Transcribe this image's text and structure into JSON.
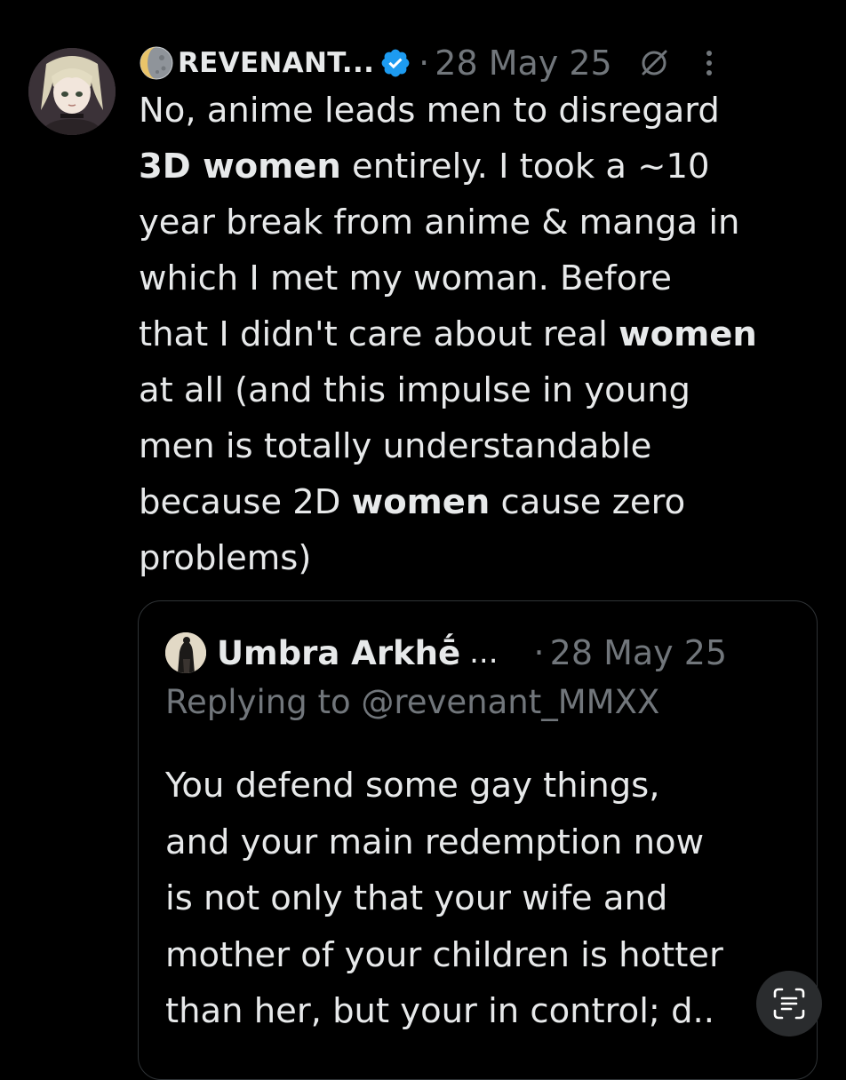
{
  "tweet": {
    "display_name": "REVENANT...",
    "separator": "·",
    "date": "28 May 25",
    "text_lines": [
      [
        {
          "t": "No, anime leads men to disregard",
          "b": false
        }
      ],
      [
        {
          "t": "3D women",
          "b": true
        },
        {
          "t": " entirely. I took a ~10",
          "b": false
        }
      ],
      [
        {
          "t": "year break from anime & manga in",
          "b": false
        }
      ],
      [
        {
          "t": "which I met my woman. Before",
          "b": false
        }
      ],
      [
        {
          "t": "that I didn't care about real ",
          "b": false
        },
        {
          "t": "women",
          "b": true
        }
      ],
      [
        {
          "t": "at all (and this impulse in young",
          "b": false
        }
      ],
      [
        {
          "t": "men is totally understandable",
          "b": false
        }
      ],
      [
        {
          "t": "because 2D ",
          "b": false
        },
        {
          "t": "women",
          "b": true
        },
        {
          "t": " cause zero",
          "b": false
        }
      ],
      [
        {
          "t": "problems)",
          "b": false
        }
      ]
    ]
  },
  "quote": {
    "display_name": "Umbra Arkhḗ",
    "ellipsis": "...",
    "separator": "·",
    "date": "28 May 25",
    "replying_to": "Replying to @revenant_MMXX",
    "text_lines": [
      "You defend some gay things,",
      "and your main redemption now",
      "is not only that your wife and",
      "mother of your children is hotter",
      "than her, but your in control; d.."
    ]
  },
  "icons": {
    "moon": "moon-icon",
    "verified": "verified-badge-icon",
    "hidden": "hidden-reply-icon",
    "more": "more-options-icon",
    "scan": "scan-text-icon"
  },
  "colors": {
    "background": "#000000",
    "text": "#e7e9ea",
    "muted": "#71767b",
    "verified": "#1d9bf0",
    "card_border": "#2f3336"
  }
}
